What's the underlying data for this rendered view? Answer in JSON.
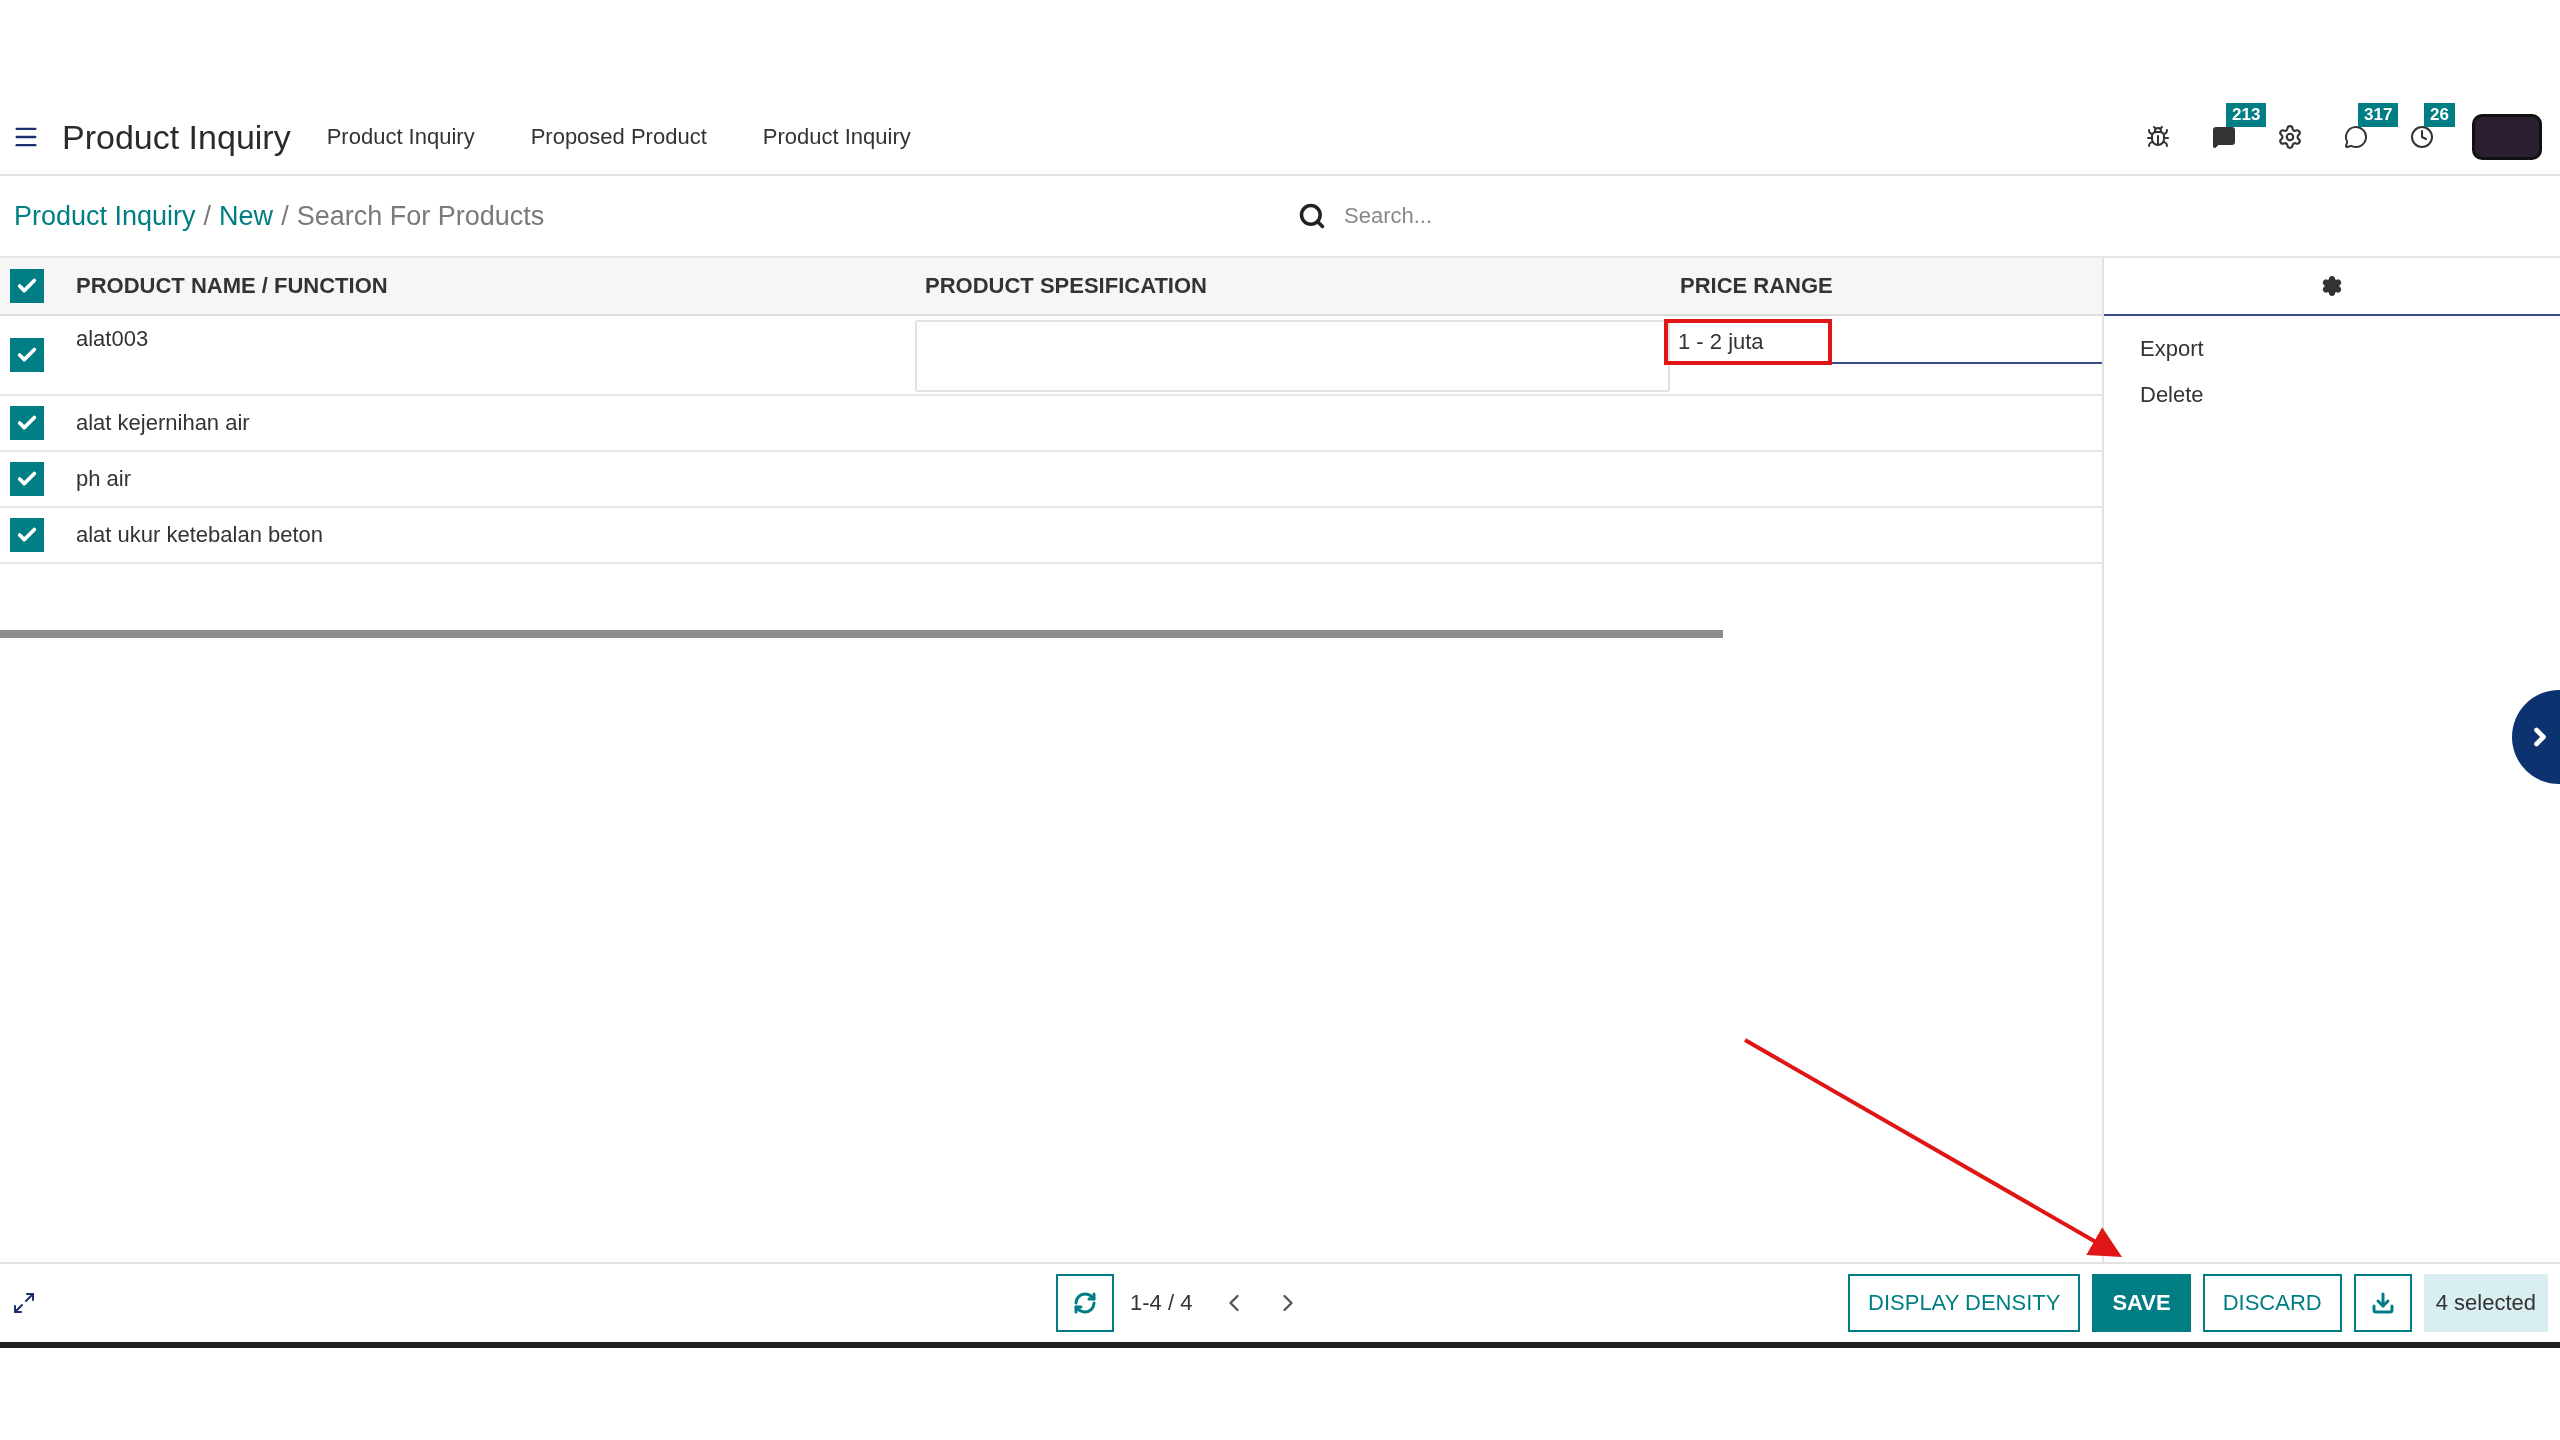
{
  "navbar": {
    "app_title": "Product Inquiry",
    "menu": [
      "Product Inquiry",
      "Proposed Product",
      "Product Inquiry"
    ],
    "systray": [
      {
        "kind": "bug"
      },
      {
        "kind": "chat",
        "badge": "213"
      },
      {
        "kind": "gear"
      },
      {
        "kind": "whatsapp",
        "badge": "317"
      },
      {
        "kind": "clock",
        "badge": "26"
      },
      {
        "kind": "avatar"
      }
    ]
  },
  "breadcrumb": [
    {
      "label": "Product Inquiry",
      "link": true
    },
    {
      "separator": "/",
      "label": "New",
      "link": true
    },
    {
      "separator": "/",
      "label": "Search For Products",
      "link": false
    }
  ],
  "search": {
    "placeholder": "Search..."
  },
  "table": {
    "all_checked": true,
    "columns": [
      "PRODUCT NAME / FUNCTION",
      "PRODUCT SPESIFICATION",
      "PRICE RANGE"
    ],
    "rows": [
      {
        "checked": true,
        "name": "alat003",
        "editing": true,
        "price": "1 - 2 juta",
        "price_highlighted": true
      },
      {
        "checked": true,
        "name": "alat kejernihan air",
        "editing": false
      },
      {
        "checked": true,
        "name": "ph air",
        "editing": false
      },
      {
        "checked": true,
        "name": "alat ukur ketebalan beton",
        "editing": false
      }
    ]
  },
  "side_panel": {
    "actions": [
      "Export",
      "Delete"
    ]
  },
  "footer": {
    "pager": "1-4 / 4",
    "buttons": [
      {
        "kind": "outline",
        "label": "DISPLAY DENSITY"
      },
      {
        "kind": "primary",
        "label": "SAVE"
      },
      {
        "kind": "outline",
        "label": "DISCARD"
      },
      {
        "kind": "download"
      }
    ],
    "selected_count": "4 selected"
  }
}
